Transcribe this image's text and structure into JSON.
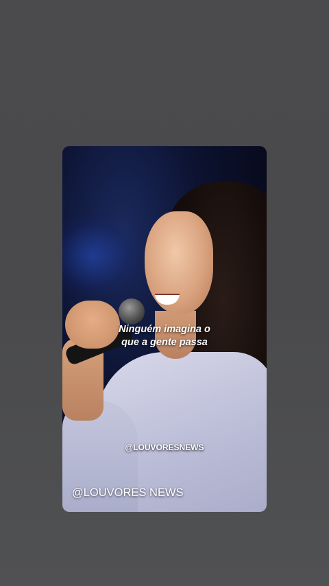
{
  "story": {
    "lyric_line_1": "Ninguém imagina o",
    "lyric_line_2": "que a gente passa",
    "watermark": "@LOUVORESNEWS",
    "brand_label": "@LOUVORES NEWS"
  },
  "colors": {
    "background": "#4b4a4d",
    "text": "#ffffff"
  }
}
